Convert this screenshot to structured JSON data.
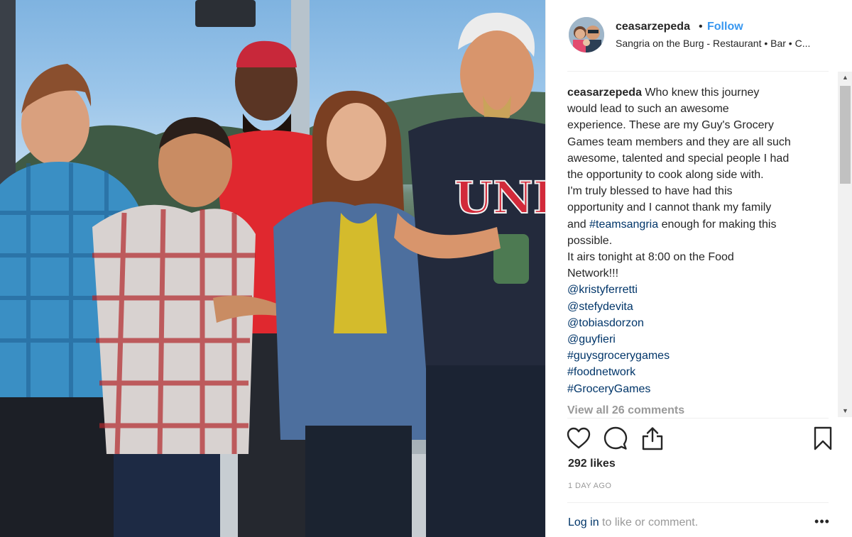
{
  "post": {
    "username": "ceasarzepeda",
    "separator": "•",
    "follow_label": "Follow",
    "location": "Sangria on the Burg - Restaurant • Bar • C...",
    "caption_lines": [
      "Who knew this journey",
      "would lead to such an awesome",
      "experience. These are my Guy's Grocery",
      "Games team members and they are all such",
      "awesome, talented and special people I had",
      "the opportunity to cook along side with.",
      "I'm truly blessed to have had this",
      "opportunity and I cannot thank my family",
      "and",
      "enough for making this",
      "possible.",
      "It airs tonight at 8:00 on the Food",
      "Network!!!"
    ],
    "inline_hashtag": "#teamsangria",
    "mentions": [
      "@kristyferretti",
      "@stefydevita",
      "@tobiasdorzon",
      "@guyfieri",
      "#guysgrocerygames",
      "#foodnetwork",
      "#GroceryGames"
    ],
    "view_all_comments": "View all 26 comments",
    "likes": "292 likes",
    "time_ago": "1 DAY AGO",
    "login_link": "Log in",
    "login_rest": " to like or comment.",
    "more_glyph": "•••",
    "scroll_up_glyph": "▲",
    "scroll_down_glyph": "▼"
  },
  "icons": {
    "like": "heart-icon",
    "comment": "comment-bubble-icon",
    "share": "share-icon",
    "save": "bookmark-icon"
  },
  "colors": {
    "follow": "#3897f0",
    "hashtag": "#003569",
    "muted": "#999999",
    "text": "#262626"
  }
}
